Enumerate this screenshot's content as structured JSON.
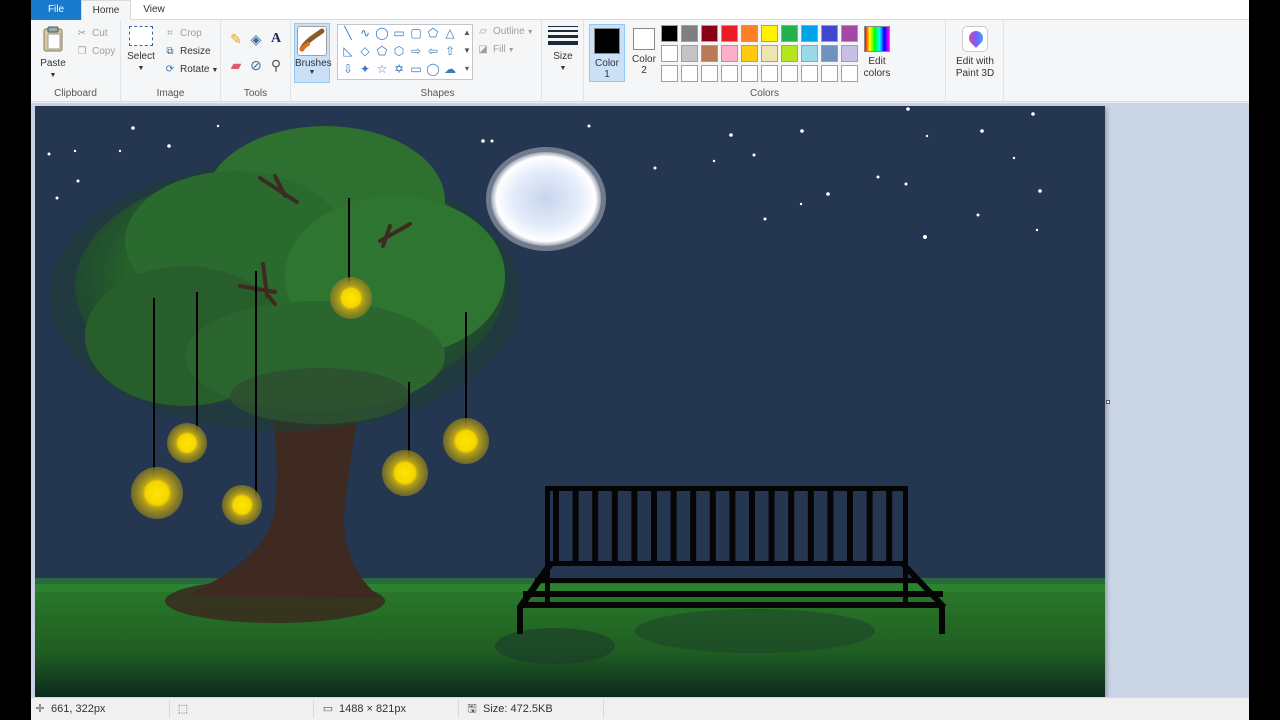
{
  "tabs": {
    "file": "File",
    "home": "Home",
    "view": "View"
  },
  "clipboard": {
    "paste": "Paste",
    "cut": "Cut",
    "copy": "Copy",
    "group": "Clipboard"
  },
  "image": {
    "select": "Select",
    "crop": "Crop",
    "resize": "Resize",
    "rotate": "Rotate",
    "group": "Image"
  },
  "tools": {
    "group": "Tools"
  },
  "brushes": {
    "label": "Brushes"
  },
  "shapes": {
    "outline": "Outline",
    "fill": "Fill",
    "group": "Shapes"
  },
  "size": {
    "label": "Size"
  },
  "colors": {
    "color1": "Color",
    "color1_num": "1",
    "color2": "Color",
    "color2_num": "2",
    "edit": "Edit",
    "edit2": "colors",
    "group": "Colors",
    "color1_value": "#000000",
    "color2_value": "#ffffff",
    "palette_row1": [
      "#000000",
      "#7f7f7f",
      "#880015",
      "#ed1c24",
      "#ff7f27",
      "#fff200",
      "#22b14c",
      "#00a2e8",
      "#3f48cc",
      "#a349a4"
    ],
    "palette_row2": [
      "#ffffff",
      "#c3c3c3",
      "#b97a57",
      "#ffaec9",
      "#ffc90e",
      "#efe4b0",
      "#b5e61d",
      "#99d9ea",
      "#7092be",
      "#c8bfe7"
    ],
    "palette_row3": [
      "#ffffff",
      "#ffffff",
      "#ffffff",
      "#ffffff",
      "#ffffff",
      "#ffffff",
      "#ffffff",
      "#ffffff",
      "#ffffff",
      "#ffffff"
    ]
  },
  "paint3d": {
    "line1": "Edit with",
    "line2": "Paint 3D"
  },
  "status": {
    "cursor": "661, 322px",
    "dimensions": "1488 × 821px",
    "size": "Size: 472.5KB"
  }
}
